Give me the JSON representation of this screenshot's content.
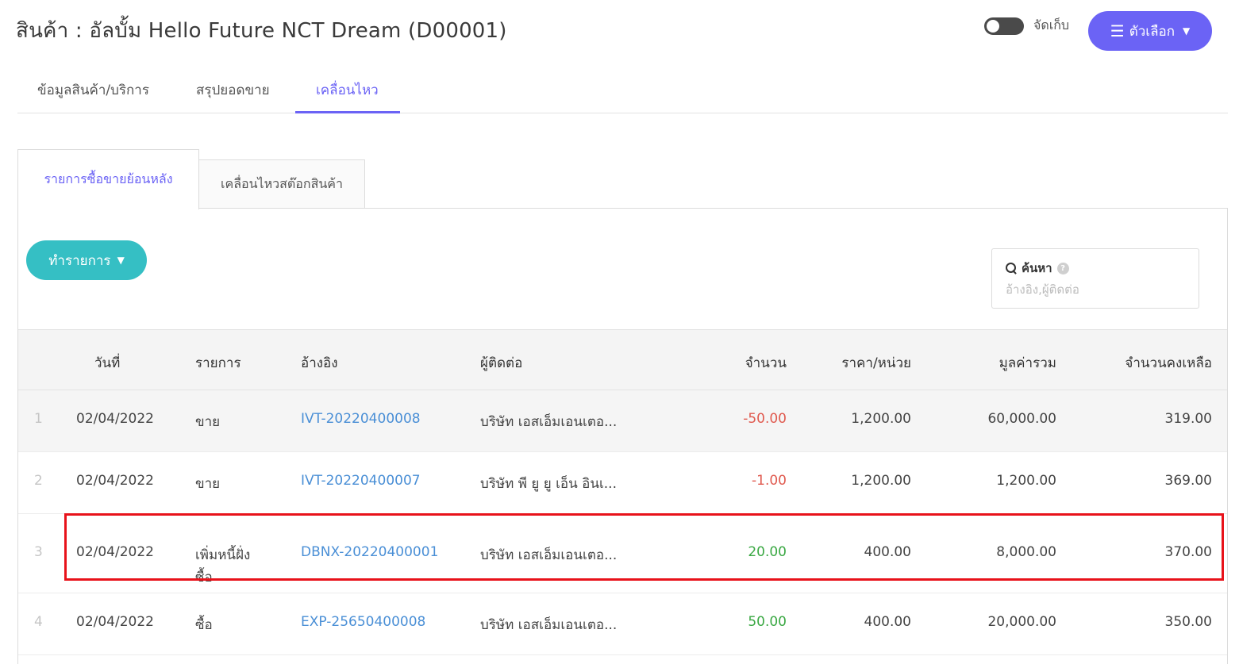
{
  "header": {
    "title": "สินค้า : อัลบั้ม Hello Future NCT Dream (D00001)",
    "archive_label": "จัดเก็บ",
    "options_label": "ตัวเลือก"
  },
  "tabs": [
    {
      "label": "ข้อมูลสินค้า/บริการ",
      "active": false
    },
    {
      "label": "สรุปยอดขาย",
      "active": false
    },
    {
      "label": "เคลื่อนไหว",
      "active": true
    }
  ],
  "subtabs": [
    {
      "label": "รายการซื้อขายย้อนหลัง",
      "active": true
    },
    {
      "label": "เคลื่อนไหวสต๊อกสินค้า",
      "active": false
    }
  ],
  "toolbar": {
    "action_label": "ทำรายการ"
  },
  "search": {
    "label": "ค้นหา",
    "placeholder": "อ้างอิง,ผู้ติดต่อ"
  },
  "table": {
    "columns": [
      "วันที่",
      "รายการ",
      "อ้างอิง",
      "ผู้ติดต่อ",
      "จำนวน",
      "ราคา/หน่วย",
      "มูลค่ารวม",
      "จำนวนคงเหลือ"
    ],
    "rows": [
      {
        "no": "1",
        "date": "02/04/2022",
        "type": "ขาย",
        "type2": "",
        "ref": "IVT-20220400008",
        "contact": "บริษัท เอสเอ็มเอนเตอ...",
        "qty": "-50.00",
        "qty_sign": "neg",
        "price": "1,200.00",
        "total": "60,000.00",
        "balance": "319.00"
      },
      {
        "no": "2",
        "date": "02/04/2022",
        "type": "ขาย",
        "type2": "",
        "ref": "IVT-20220400007",
        "contact": "บริษัท พี ยู ยู เอ็น อินเ...",
        "qty": "-1.00",
        "qty_sign": "neg",
        "price": "1,200.00",
        "total": "1,200.00",
        "balance": "369.00"
      },
      {
        "no": "3",
        "date": "02/04/2022",
        "type": "เพิ่มหนี้ฝั่ง",
        "type2": "ซื้อ",
        "ref": "DBNX-20220400001",
        "contact": "บริษัท เอสเอ็มเอนเตอ...",
        "qty": "20.00",
        "qty_sign": "pos",
        "price": "400.00",
        "total": "8,000.00",
        "balance": "370.00"
      },
      {
        "no": "4",
        "date": "02/04/2022",
        "type": "ซื้อ",
        "type2": "",
        "ref": "EXP-25650400008",
        "contact": "บริษัท เอสเอ็มเอนเตอ...",
        "qty": "50.00",
        "qty_sign": "pos",
        "price": "400.00",
        "total": "20,000.00",
        "balance": "350.00"
      }
    ]
  },
  "colors": {
    "accent": "#6b63f5",
    "teal": "#35bfc4",
    "link": "#4a8fd6",
    "negative": "#e05a4f",
    "positive": "#3aa843",
    "highlight": "#e8121a"
  }
}
